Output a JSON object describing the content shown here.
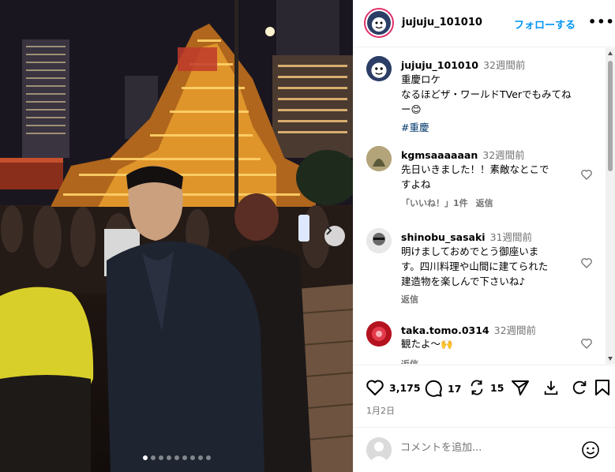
{
  "post": {
    "author": "jujuju_101010",
    "follow_label": "フォローする",
    "more_label": "•••",
    "carousel": {
      "total": 9,
      "active": 0
    }
  },
  "caption": {
    "username": "jujuju_101010",
    "time": "32週間前",
    "text": "重慶ロケ\nなるほどザ・ワールドTVerでもみてね\nー😊",
    "hashtag": "#重慶"
  },
  "comments": [
    {
      "username": "kgmsaaaaaan",
      "time": "32週間前",
      "text": "先日いきました！！素敵なとこで\nすよね",
      "likes": "「いいね！」1件",
      "reply": "返信"
    },
    {
      "username": "shinobu_sasaki",
      "time": "31週間前",
      "text": "明けましておめでとう御座いま\nす。四川料理や山間に建てられた\n建造物を楽しんで下さいね♪",
      "likes": "",
      "reply": "返信"
    },
    {
      "username": "taka.tomo.0314",
      "time": "32週間前",
      "text": "観たよ〜🙌",
      "likes": "",
      "reply": "返信"
    }
  ],
  "actions": {
    "likes": "3,175",
    "comments": "17",
    "reposts": "15",
    "date": "1月2日"
  },
  "comment_box": {
    "placeholder": "コメントを追加..."
  }
}
